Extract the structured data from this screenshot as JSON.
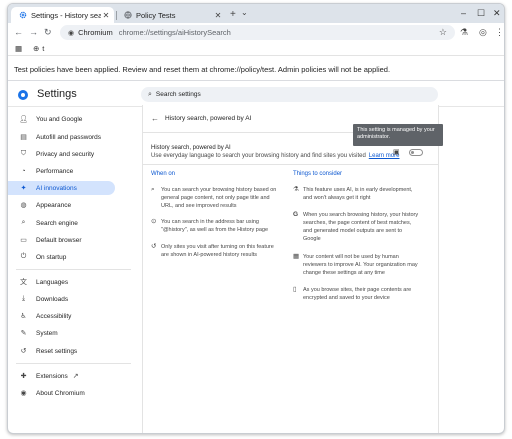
{
  "browser": {
    "tabs": [
      {
        "label": "Settings - History search",
        "icon": "gear-icon",
        "active": true
      },
      {
        "label": "Policy Tests",
        "icon": "globe-icon",
        "active": false
      }
    ],
    "new_tab": "+",
    "omnibox": {
      "site": "Chromium",
      "url": "chrome://settings/aiHistorySearch"
    },
    "bookmark_label": "t"
  },
  "infobar": {
    "text": "Test policies have been applied. Review and reset them at chrome://policy/test. Admin policies will not be applied."
  },
  "settings": {
    "title": "Settings",
    "search_placeholder": "Search settings"
  },
  "sidebar": {
    "items": [
      {
        "label": "You and Google",
        "icon": "person-icon"
      },
      {
        "label": "Autofill and passwords",
        "icon": "clipboard-icon"
      },
      {
        "label": "Privacy and security",
        "icon": "shield-icon"
      },
      {
        "label": "Performance",
        "icon": "gauge-icon"
      },
      {
        "label": "AI innovations",
        "icon": "sparkle-icon",
        "active": true
      },
      {
        "label": "Appearance",
        "icon": "palette-icon"
      },
      {
        "label": "Search engine",
        "icon": "search-icon"
      },
      {
        "label": "Default browser",
        "icon": "browser-icon"
      },
      {
        "label": "On startup",
        "icon": "power-icon"
      },
      {
        "label": "Languages",
        "icon": "translate-icon"
      },
      {
        "label": "Downloads",
        "icon": "download-icon"
      },
      {
        "label": "Accessibility",
        "icon": "accessibility-icon"
      },
      {
        "label": "System",
        "icon": "wrench-icon"
      },
      {
        "label": "Reset settings",
        "icon": "reset-icon"
      },
      {
        "label": "Extensions",
        "icon": "puzzle-icon"
      },
      {
        "label": "About Chromium",
        "icon": "chromium-icon"
      }
    ]
  },
  "page": {
    "title": "History search, powered by AI",
    "tooltip": "This setting is managed by your administrator.",
    "feature": {
      "title": "History search, powered by AI",
      "description": "Use everyday language to search your browsing history and find sites you visited",
      "learn_more": "Learn more",
      "enabled": false
    },
    "when_on": {
      "title": "When on",
      "items": [
        {
          "icon": "history-search-icon",
          "lines": [
            "You can search your browsing history based on",
            "general page content, not only page title and",
            "URL, and see improved results"
          ]
        },
        {
          "icon": "omnibox-search-icon",
          "lines": [
            "You can search in the address bar using",
            "\"@history\", as well as from the History page"
          ]
        },
        {
          "icon": "history-icon",
          "lines": [
            "Only sites you visit after turning on this feature",
            "are shown in AI-powered history results"
          ]
        }
      ]
    },
    "things_to_consider": {
      "title": "Things to consider",
      "items": [
        {
          "icon": "experiment-icon",
          "lines": [
            "This feature uses AI, is in early development,",
            "and won't always get it right"
          ]
        },
        {
          "icon": "google-g-icon",
          "lines": [
            "When you search browsing history, your history",
            "searches, the page content of best matches,",
            "and generated model outputs are sent to",
            "Google"
          ]
        },
        {
          "icon": "business-icon",
          "lines": [
            "Your content will not be used by human",
            "reviewers to improve AI. Your organization may",
            "change these settings at any time"
          ]
        },
        {
          "icon": "document-lock-icon",
          "lines": [
            "As you browse sites, their page contents are",
            "encrypted and saved to your device"
          ]
        }
      ]
    }
  },
  "colors": {
    "accent": "#0b57d0",
    "active_nav_bg": "#d3e3fd",
    "tab_strip": "#dde3ea",
    "tooltip_bg": "#5f6368"
  }
}
